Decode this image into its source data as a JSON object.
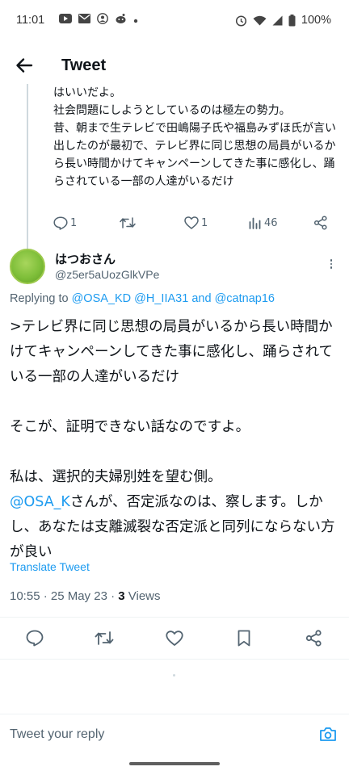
{
  "status_bar": {
    "time": "11:01",
    "battery": "100%",
    "left_icons": [
      "youtube-icon",
      "mail-icon",
      "app-icon",
      "reddit-icon",
      "dot-icon"
    ],
    "right_icons": [
      "alarm-icon",
      "wifi-icon",
      "signal-icon",
      "battery-icon"
    ]
  },
  "header": {
    "title": "Tweet"
  },
  "parent_tweet": {
    "text": "はいいだよ。\n社会問題にしようとしているのは極左の勢力。\n昔、朝まで生テレビで田嶋陽子氏や福島みずほ氏が言い出したのが最初で、テレビ界に同じ思想の局員がいるから長い時間かけてキャンペーンしてきた事に感化し、踊らされている一部の人達がいるだけ",
    "replies": "1",
    "retweets": "",
    "likes": "1",
    "views": "46"
  },
  "tweet": {
    "display_name": "はつおさん",
    "handle": "@z5er5aUozGlkVPe",
    "replying_prefix": "Replying to",
    "replying_to": [
      "@OSA_KD",
      "@H_IIA31",
      "and",
      "@catnap16"
    ],
    "body_p1": ">テレビ界に同じ思想の局員がいるから長い時間かけてキャンペーンしてきた事に感化し、踊らされている一部の人達がいるだけ",
    "body_p2": "そこが、証明できない話なのですよ。",
    "body_p3_line1": "私は、選択的夫婦別姓を望む側。",
    "body_p3_mention": "@OSA_K",
    "body_p3_rest": "さんが、否定派なのは、察します。しかし、あなたは支離滅裂な否定派と同列にならない方が良い",
    "translate": "Translate Tweet",
    "time": "10:55 · 25 May 23 · ",
    "views_count": "3",
    "views_label": " Views"
  },
  "reply": {
    "placeholder": "Tweet your reply"
  },
  "colors": {
    "accent": "#1d9bf0",
    "text": "#0f1419",
    "muted": "#536471"
  }
}
